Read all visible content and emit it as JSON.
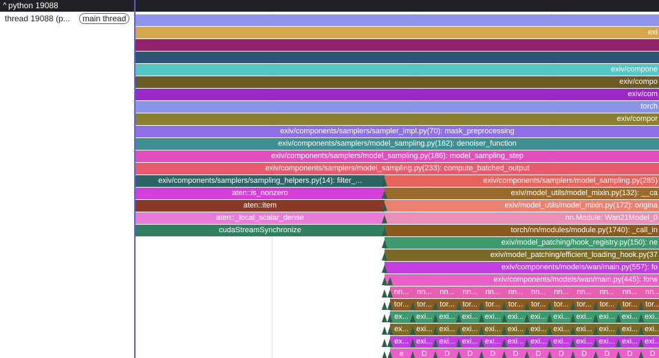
{
  "topbar": {
    "process_label": "python 19088",
    "chevron": "^"
  },
  "thread": {
    "name": "thread 19088 (p...",
    "badge": "main thread"
  },
  "colors": {
    "accent_divider": "#5b5be6"
  },
  "flame": {
    "full_rows": [
      {
        "label": "",
        "color": "#8f95e9",
        "align": "right"
      },
      {
        "label": "exi",
        "color": "#d6a74a",
        "align": "right"
      },
      {
        "label": "",
        "color": "#941f6b",
        "align": "right"
      },
      {
        "label": "",
        "color": "#2f5575",
        "align": "right"
      },
      {
        "label": "exiv/compone",
        "color": "#52c5c5",
        "align": "right"
      },
      {
        "label": "exiv/compo",
        "color": "#6b5a24",
        "align": "right"
      },
      {
        "label": "exiv/com",
        "color": "#9c28c8",
        "align": "right"
      },
      {
        "label": "torch",
        "color": "#8a95e7",
        "align": "right"
      },
      {
        "label": "exiv/compor",
        "color": "#8b7e2c",
        "align": "right"
      },
      {
        "label": "exiv/components/samplers/sampler_impl.py(70): mask_preprocessing",
        "color": "#8f6fe6",
        "align": "center"
      },
      {
        "label": "exiv/components/samplers/model_sampling.py(162): denoiser_function",
        "color": "#3e9090",
        "align": "center"
      },
      {
        "label": "exiv/components/samplers/model_sampling.py(186): model_sampling_step",
        "color": "#e24fbd",
        "align": "center"
      },
      {
        "label": "exiv/components/samplers/model_sampling.py(233): compute_batched_output",
        "color": "#e85c6d",
        "align": "center"
      }
    ],
    "left_rows": [
      {
        "label": "exiv/components/samplers/sampling_helpers.py(14): filter_...",
        "color": "#2c6567"
      },
      {
        "label": "aten::is_nonzero",
        "color": "#d63ed9"
      },
      {
        "label": "aten::item",
        "color": "#8a3a24"
      },
      {
        "label": "aten::_local_scalar_dense",
        "color": "#ea7cd9"
      },
      {
        "label": "cudaStreamSynchronize",
        "color": "#2e8060"
      }
    ],
    "right_rows": [
      {
        "label": "exiv/components/samplers/model_sampling.py(285)",
        "color": "#e9635d"
      },
      {
        "label": "exiv/model_utils/model_mixin.py(132): __ca",
        "color": "#9a6a2a"
      },
      {
        "label": "exiv/model_utils/model_mixin.py(172): origina",
        "color": "#ea8070"
      },
      {
        "label": "nn.Module: Wan21Model_0",
        "color": "#ea8fb6"
      },
      {
        "label": "torch/nn/modules/module.py(1740): _call_in",
        "color": "#8a5a1e"
      },
      {
        "label": "exiv/model_patching/hook_registry.py(150): ne",
        "color": "#3c9a6c"
      },
      {
        "label": "exiv/model_patching/efficient_loading_hook.py(37",
        "color": "#7a6a24"
      },
      {
        "label": "exiv/components/models/wan/main.py(557): fo",
        "color": "#c23ee0"
      },
      {
        "label": "exiv/components/models/wan/main.py(445): forw",
        "color": "#ea5fc8"
      }
    ],
    "repeated_rows": [
      {
        "cells": [
          "nn...",
          "nn...",
          "nn...",
          "nn...",
          "nn...",
          "nn...",
          "nn...",
          "nn...",
          "nn...",
          "nn...",
          "nn...",
          "nn..."
        ],
        "color": "#e65fb0"
      },
      {
        "cells": [
          "tor...",
          "tor...",
          "tor...",
          "tor...",
          "tor...",
          "tor...",
          "tor...",
          "tor...",
          "tor...",
          "tor...",
          "tor...",
          "tor..."
        ],
        "color": "#8a5a1e"
      },
      {
        "cells": [
          "ex...",
          "exi...",
          "exi...",
          "exi...",
          "exi...",
          "exi...",
          "exi...",
          "exi...",
          "exi...",
          "exi...",
          "exi...",
          "exi..."
        ],
        "color": "#3c9a6c"
      },
      {
        "cells": [
          "ex...",
          "exi...",
          "exi...",
          "exi...",
          "exi...",
          "exi...",
          "exi...",
          "exi...",
          "exi...",
          "exi...",
          "exi...",
          "exi..."
        ],
        "color": "#7a6a24"
      },
      {
        "cells": [
          "ex...",
          "exi...",
          "exi...",
          "exi...",
          "exi...",
          "exi...",
          "exi...",
          "exi...",
          "exi...",
          "exi...",
          "exi...",
          "exi..."
        ],
        "color": "#c23ee0"
      },
      {
        "cells": [
          "e",
          "D",
          "D",
          "D",
          "D",
          "D",
          "D",
          "D",
          "D",
          "D",
          "D",
          "D"
        ],
        "color": "#ea5fc8"
      }
    ]
  }
}
